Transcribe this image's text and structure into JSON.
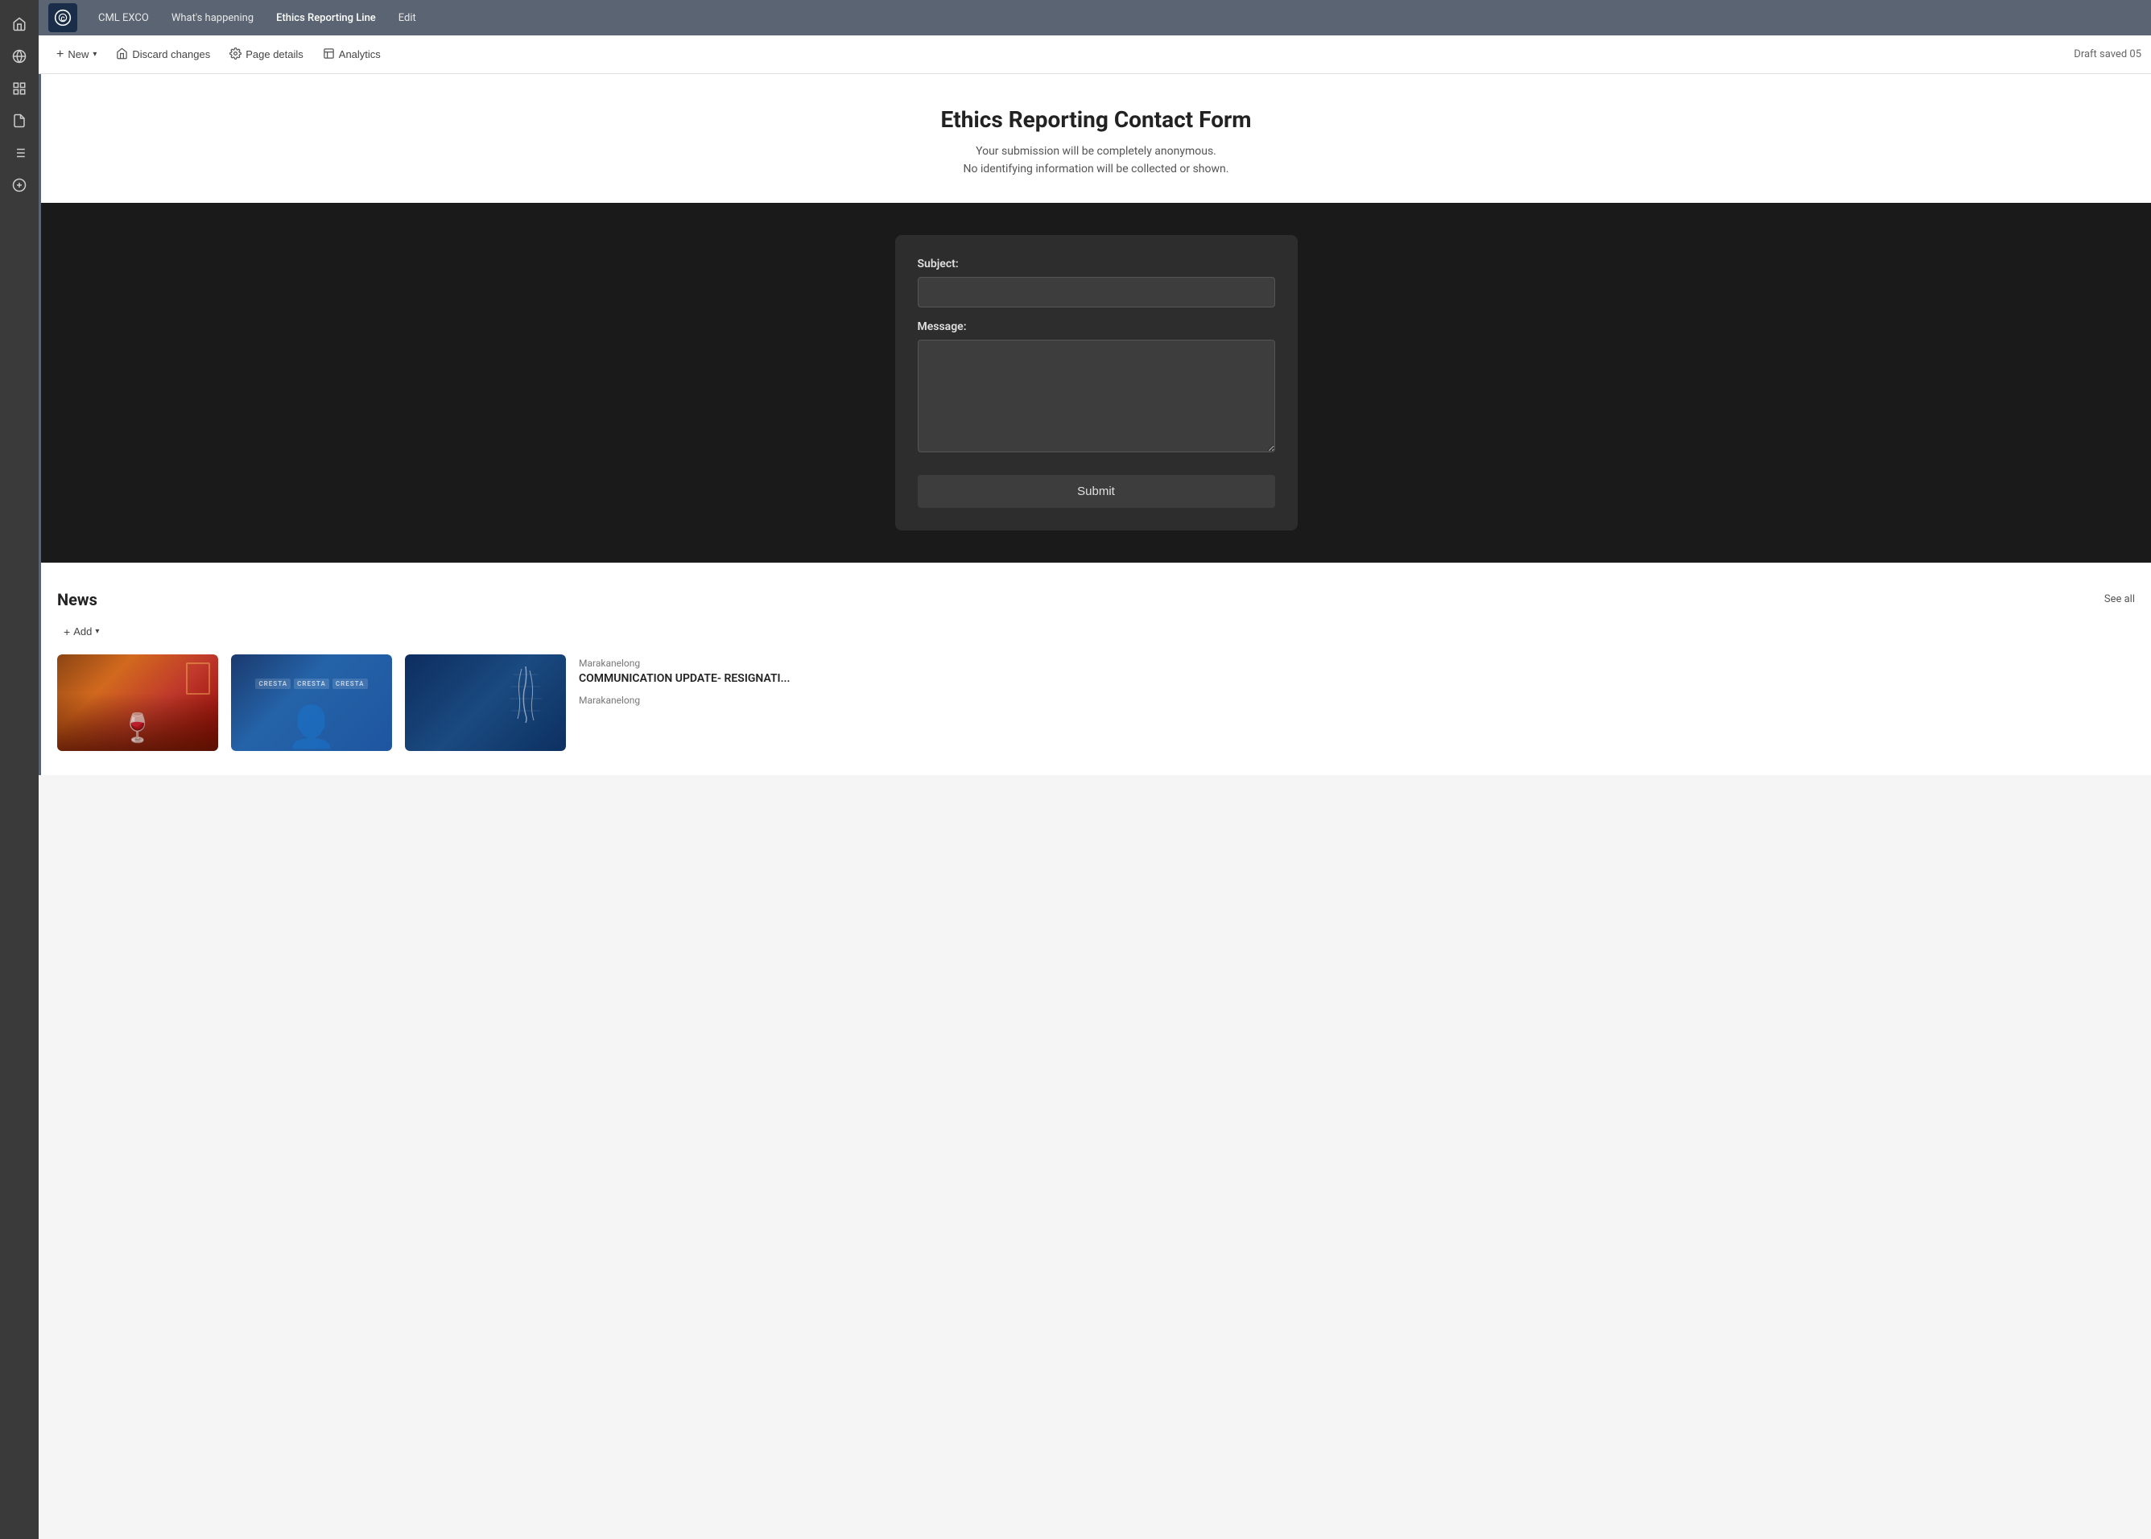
{
  "app": {
    "logo_text": "C",
    "logo_bg": "#1a2e4a"
  },
  "top_nav": {
    "brand": "CML EXCO",
    "items": [
      {
        "label": "What's happening",
        "active": false
      },
      {
        "label": "Ethics Reporting Line",
        "active": true
      },
      {
        "label": "Edit",
        "active": false
      }
    ]
  },
  "toolbar": {
    "new_label": "New",
    "discard_label": "Discard changes",
    "page_details_label": "Page details",
    "analytics_label": "Analytics",
    "draft_status": "Draft saved 05"
  },
  "page": {
    "title": "Ethics Reporting Contact Form",
    "subtitle_line1": "Your submission will be completely anonymous.",
    "subtitle_line2": "No identifying information will be collected or shown.",
    "form": {
      "subject_label": "Subject:",
      "subject_placeholder": "",
      "message_label": "Message:",
      "message_placeholder": "",
      "submit_label": "Submit"
    }
  },
  "news": {
    "title": "News",
    "see_all_label": "See all",
    "add_label": "Add",
    "items": [
      {
        "type": "image",
        "theme": "wine"
      },
      {
        "type": "image",
        "theme": "cresta_person"
      },
      {
        "type": "image",
        "theme": "map"
      },
      {
        "type": "text",
        "author": "Marakanelong",
        "headline": "COMMUNICATION UPDATE- RESIGNATI...",
        "author2": "Marakanelong"
      }
    ]
  },
  "sidebar": {
    "icons": [
      {
        "name": "home-icon",
        "symbol": "⌂"
      },
      {
        "name": "globe-icon",
        "symbol": "🌐"
      },
      {
        "name": "grid-icon",
        "symbol": "⊞"
      },
      {
        "name": "document-icon",
        "symbol": "📄"
      },
      {
        "name": "list-icon",
        "symbol": "☰"
      },
      {
        "name": "add-circle-icon",
        "symbol": "⊕"
      }
    ]
  }
}
